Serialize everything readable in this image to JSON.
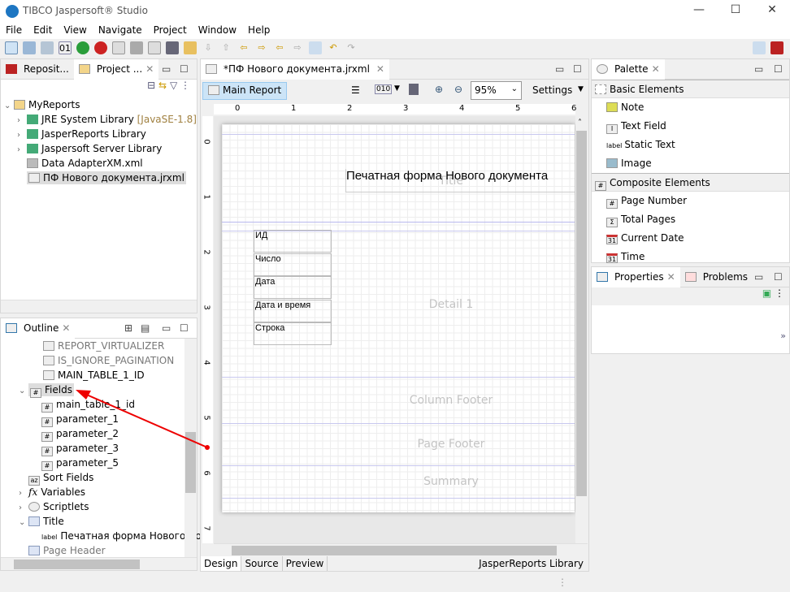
{
  "window": {
    "title": "TIBCO Jaspersoft® Studio"
  },
  "menu": [
    "File",
    "Edit",
    "View",
    "Navigate",
    "Project",
    "Window",
    "Help"
  ],
  "project": {
    "tabs": [
      "Reposit...",
      "Project ..."
    ],
    "tree": [
      {
        "label": "MyReports"
      },
      {
        "label": "JRE System Library",
        "suffix": "[JavaSE-1.8]"
      },
      {
        "label": "JasperReports Library"
      },
      {
        "label": "Jaspersoft Server Library"
      },
      {
        "label": "Data AdapterXM.xml"
      },
      {
        "label": "ПФ Нового документа.jrxml"
      }
    ]
  },
  "outline": {
    "tab": "Outline",
    "items": [
      "REPORT_VIRTUALIZER",
      "IS_IGNORE_PAGINATION",
      "MAIN_TABLE_1_ID",
      "Fields",
      "main_table_1_id",
      "parameter_1",
      "parameter_2",
      "parameter_3",
      "parameter_5",
      "Sort Fields",
      "Variables",
      "Scriptlets",
      "Title",
      "Печатная форма Нового до",
      "Page Header"
    ]
  },
  "editor": {
    "tab": "*ПФ Нового документа.jrxml",
    "main_report": "Main Report",
    "zoom": "95%",
    "settings": "Settings",
    "ruler_h": [
      "0",
      "1",
      "2",
      "3",
      "4",
      "5",
      "6"
    ],
    "ruler_v": [
      "0",
      "1",
      "2",
      "3",
      "4",
      "5",
      "6",
      "7"
    ],
    "title_text": "Печатная форма Нового документа",
    "bands": {
      "title": "Title",
      "detail": "Detail 1",
      "column_footer": "Column Footer",
      "page_footer": "Page Footer",
      "summary": "Summary"
    },
    "cells": [
      "ИД",
      "Число",
      "Дата",
      "Дата и время",
      "Строка"
    ],
    "bottom_tabs": [
      "Design",
      "Source",
      "Preview"
    ],
    "library": "JasperReports Library"
  },
  "palette": {
    "tab": "Palette",
    "basic": "Basic Elements",
    "basic_items": [
      "Note",
      "Text Field",
      "Static Text",
      "Image"
    ],
    "composite": "Composite Elements",
    "composite_items": [
      "Page Number",
      "Total Pages",
      "Current Date",
      "Time"
    ]
  },
  "properties": {
    "tabs": [
      "Properties",
      "Problems"
    ]
  },
  "colors": {
    "annotation_arrow": "#ee0000",
    "accent": "#1d76c2"
  }
}
